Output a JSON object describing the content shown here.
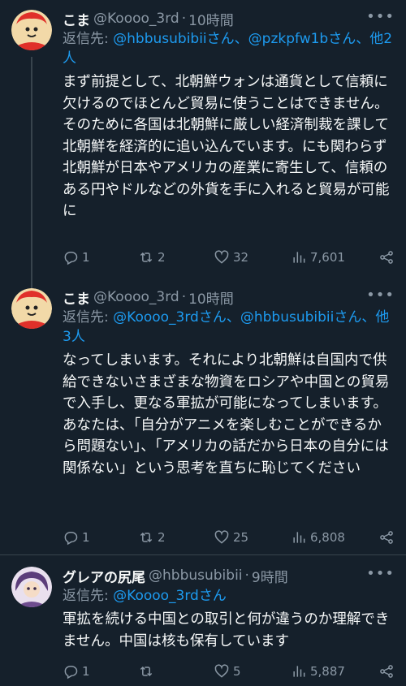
{
  "tweets": [
    {
      "display_name": "こま",
      "handle": "@Koooo_3rd",
      "sep": "·",
      "time": "10時間",
      "reply_prefix": "返信先: ",
      "reply_links": "@hbbusubibiiさん、@pzkpfw1bさん、他2人",
      "body": "まず前提として、北朝鮮ウォンは通貨として信頼に欠けるのでほとんど貿易に使うことはできません。\nそのために各国は北朝鮮に厳しい経済制裁を課して北朝鮮を経済的に追い込んでいます。にも関わらず北朝鮮が日本やアメリカの産業に寄生して、信頼のある円やドルなどの外貨を手に入れると貿易が可能に",
      "replies": "1",
      "retweets": "2",
      "likes": "32",
      "views": "7,601"
    },
    {
      "display_name": "こま",
      "handle": "@Koooo_3rd",
      "sep": "·",
      "time": "10時間",
      "reply_prefix": "返信先: ",
      "reply_links": "@Koooo_3rdさん、@hbbusubibiiさん、他3人",
      "body": "なってしまいます。それにより北朝鮮は自国内で供給できないさまざまな物資をロシアや中国との貿易で入手し、更なる軍拡が可能になってしまいます。\nあなたは、「自分がアニメを楽しむことができるから問題ない」、「アメリカの話だから日本の自分には関係ない」という思考を直ちに恥じてください",
      "replies": "1",
      "retweets": "2",
      "likes": "25",
      "views": "6,808"
    },
    {
      "display_name": "グレアの尻尾",
      "handle": "@hbbusubibii",
      "sep": "·",
      "time": "9時間",
      "reply_prefix": "返信先: ",
      "reply_links": "@Koooo_3rdさん",
      "body": "軍拡を続ける中国との取引と何が違うのか理解できません。中国は核も保有しています",
      "replies": "1",
      "retweets": "",
      "likes": "5",
      "views": "5,887"
    }
  ],
  "icons": [
    "reply-icon",
    "retweet-icon",
    "like-icon",
    "views-icon",
    "share-icon",
    "more-icon"
  ],
  "colors": {
    "background": "#15202b",
    "text": "#f7f9f9",
    "secondary": "#8b98a5",
    "link": "#1d9bf0"
  }
}
